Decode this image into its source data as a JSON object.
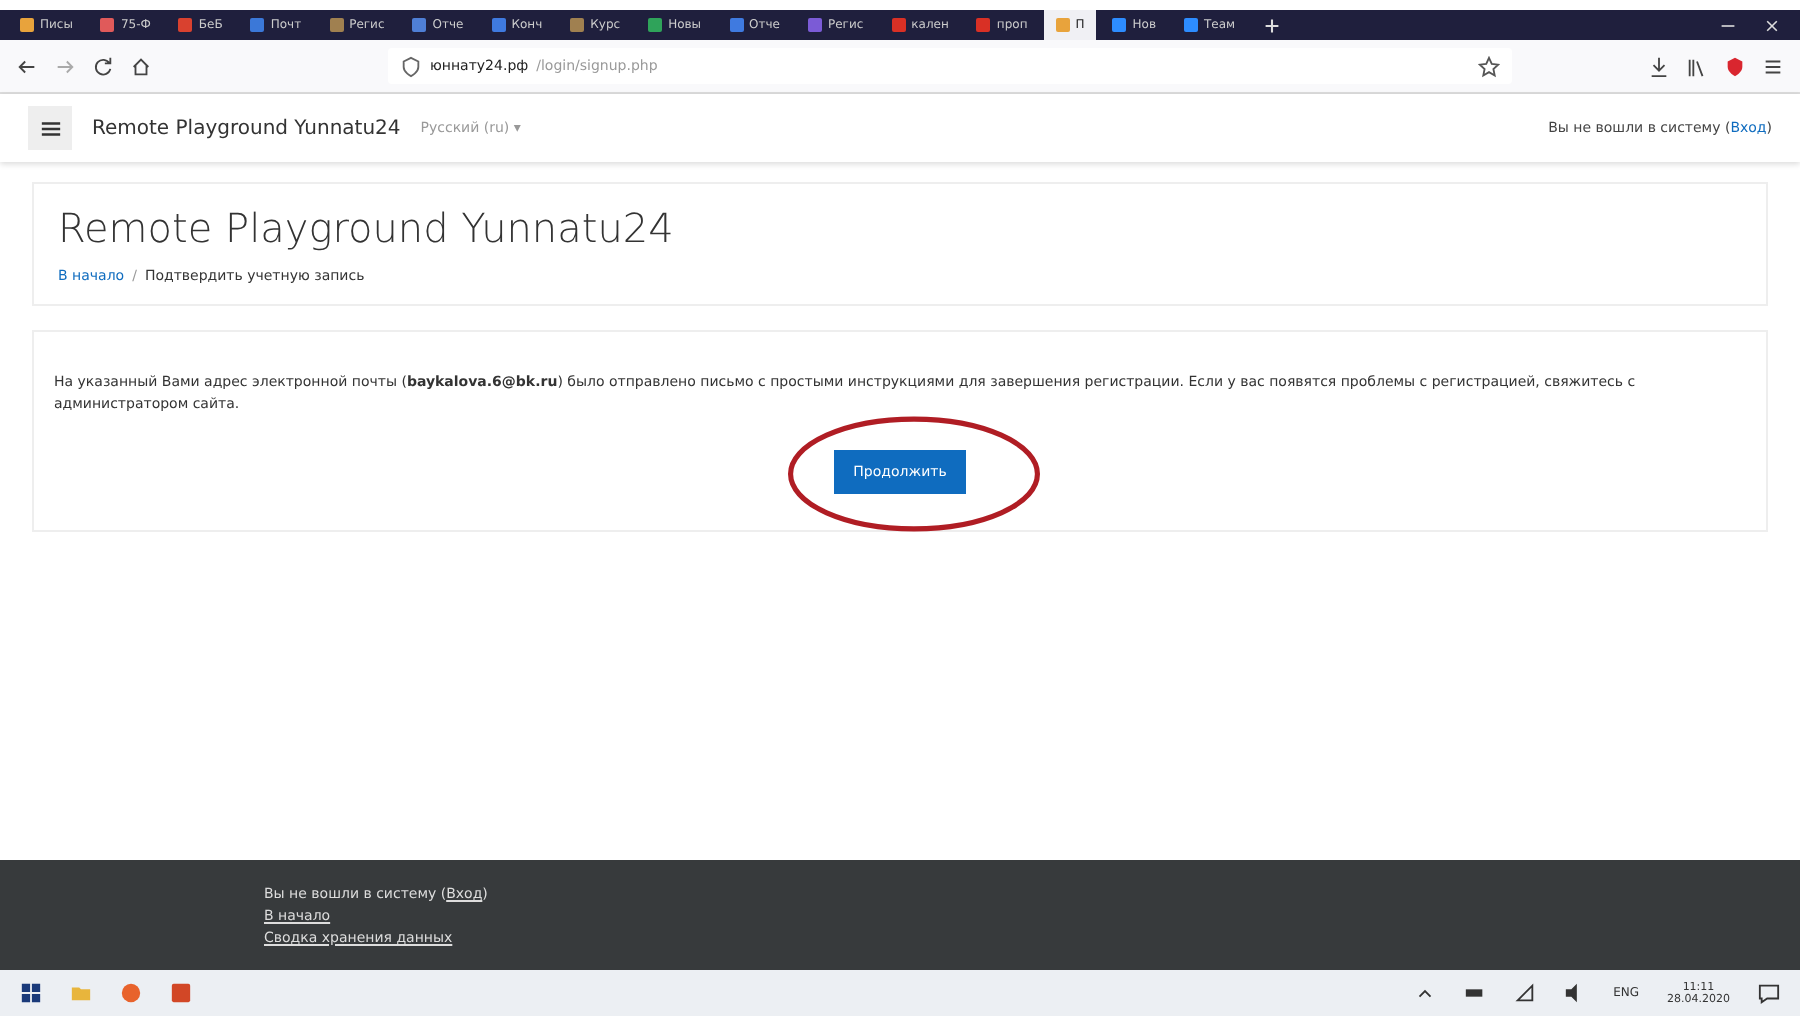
{
  "browser": {
    "tabs": [
      {
        "label": "Писы",
        "selected": false,
        "color": "#e8a33c"
      },
      {
        "label": "75-Ф",
        "selected": false,
        "color": "#e05a5a"
      },
      {
        "label": "БеБ",
        "selected": false,
        "color": "#d9412f"
      },
      {
        "label": "Почт",
        "selected": false,
        "color": "#3b78d8"
      },
      {
        "label": "Регис",
        "selected": false,
        "color": "#a08050"
      },
      {
        "label": "Отче",
        "selected": false,
        "color": "#4f7fd6"
      },
      {
        "label": "Конч",
        "selected": false,
        "color": "#3f7ae0"
      },
      {
        "label": "Курс",
        "selected": false,
        "color": "#a08050"
      },
      {
        "label": "Новы",
        "selected": false,
        "color": "#2fa35a"
      },
      {
        "label": "Отче",
        "selected": false,
        "color": "#3f7ae0"
      },
      {
        "label": "Регис",
        "selected": false,
        "color": "#7b5bd6"
      },
      {
        "label": "кален",
        "selected": false,
        "color": "#d93025"
      },
      {
        "label": "проп",
        "selected": false,
        "color": "#d93025"
      },
      {
        "label": "П",
        "selected": true,
        "color": "#e8a33c"
      },
      {
        "label": "Нов",
        "selected": false,
        "color": "#2d8cff"
      },
      {
        "label": "Теам",
        "selected": false,
        "color": "#2d8cff"
      }
    ],
    "url_host": "юннату24.рф",
    "url_path": "/login/signup.php"
  },
  "navbar": {
    "site_name": "Remote Playground Yunnatu24",
    "language": "Русский (ru)",
    "language_caret": "▾",
    "login_text": "Вы не вошли в систему (",
    "login_link": "Вход",
    "login_close": ")"
  },
  "header": {
    "title": "Remote Playground Yunnatu24",
    "breadcrumb_separator": "/",
    "breadcrumbs": [
      {
        "label": "В начало",
        "link": true
      },
      {
        "label": "Подтвердить учетную запись",
        "link": false
      }
    ]
  },
  "notice": {
    "message": "На указанный Вами адрес электронной почты (**baykalova.6@bk.ru**) было отправлено письмо с простыми инструкциями для завершения регистрации. Если у вас появятся проблемы с регистрацией, свяжитесь с администратором сайта.",
    "button": "Продолжить"
  },
  "footer": {
    "login_text": "Вы не вошли в систему (",
    "login_link": "Вход",
    "login_close": ")",
    "links": [
      "В начало",
      "Сводка хранения данных"
    ]
  },
  "taskbar": {
    "language": "ENG",
    "time": "11:11",
    "date": "28.04.2020"
  }
}
